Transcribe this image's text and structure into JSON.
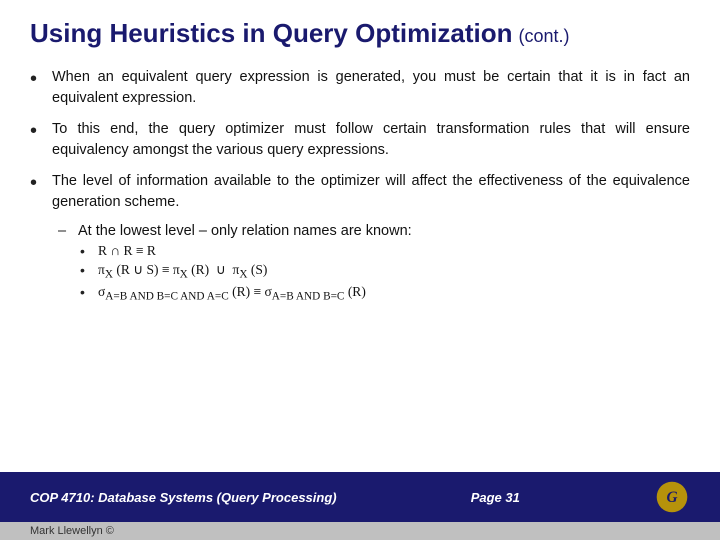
{
  "header": {
    "title": "Using Heuristics in Query Optimization",
    "cont_label": "(cont.)"
  },
  "bullets": [
    {
      "text": "When an equivalent query expression is generated, you must be certain that it is in fact an equivalent expression."
    },
    {
      "text": "To this end, the query optimizer must follow certain transformation rules that will ensure equivalency amongst the various query expressions."
    },
    {
      "text": "The level of information available to the optimizer will affect the effectiveness of the equivalence generation scheme."
    }
  ],
  "sub_bullet": {
    "dash": "–",
    "text": "At the lowest level – only relation names are known:"
  },
  "sub_sub_bullets": [
    {
      "text": "R ∩ R ≡ R"
    },
    {
      "text": "π_X (R ∪ S) ≡ π_X (R)  ∪  π_X (S)"
    },
    {
      "text": "σ_A=B AND B=C AND A=C (R) ≡ σ_A=B AND B=C (R)"
    }
  ],
  "footer": {
    "left": "COP 4710: Database Systems (Query Processing)",
    "right": "Page 31"
  },
  "footer_bottom": {
    "text": "Mark Llewellyn ©"
  }
}
